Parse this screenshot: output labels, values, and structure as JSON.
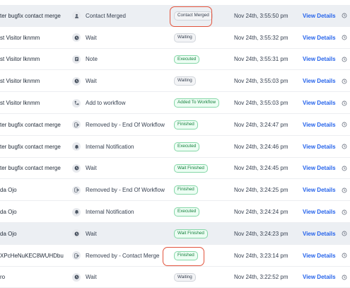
{
  "link_label": "View Details",
  "rows": [
    {
      "contact": "ter bugfix contact merge",
      "icon": "person-icon",
      "action": "Contact Merged",
      "status": "Contact Merged",
      "status_style": "grey",
      "date": "Nov 24th, 3:55:50 pm",
      "highlight": true
    },
    {
      "contact": "st Visitor lknmm",
      "icon": "clock-icon",
      "action": "Wait",
      "status": "Waiting",
      "status_style": "grey",
      "date": "Nov 24th, 3:55:32 pm",
      "highlight": false
    },
    {
      "contact": "st Visitor lknmm",
      "icon": "note-icon",
      "action": "Note",
      "status": "Executed",
      "status_style": "green",
      "date": "Nov 24th, 3:55:31 pm",
      "highlight": false
    },
    {
      "contact": "st Visitor lknmm",
      "icon": "clock-icon",
      "action": "Wait",
      "status": "Waiting",
      "status_style": "grey",
      "date": "Nov 24th, 3:55:03 pm",
      "highlight": false
    },
    {
      "contact": "st Visitor lknmm",
      "icon": "workflow-icon",
      "action": "Add to workflow",
      "status": "Added To Workflow",
      "status_style": "green",
      "date": "Nov 24th, 3:55:03 pm",
      "highlight": false
    },
    {
      "contact": "ter bugfix contact merge",
      "icon": "exit-icon",
      "action": "Removed by - End Of Workflow",
      "status": "Finished",
      "status_style": "green",
      "date": "Nov 24th, 3:24:47 pm",
      "highlight": false
    },
    {
      "contact": "ter bugfix contact merge",
      "icon": "bell-icon",
      "action": "Internal Notification",
      "status": "Executed",
      "status_style": "green",
      "date": "Nov 24th, 3:24:46 pm",
      "highlight": false
    },
    {
      "contact": "ter bugfix contact merge",
      "icon": "clock-icon",
      "action": "Wait",
      "status": "Wait Finished",
      "status_style": "green",
      "date": "Nov 24th, 3:24:45 pm",
      "highlight": false
    },
    {
      "contact": "da Ojo",
      "icon": "exit-icon",
      "action": "Removed by - End Of Workflow",
      "status": "Finished",
      "status_style": "green",
      "date": "Nov 24th, 3:24:25 pm",
      "highlight": false
    },
    {
      "contact": "da Ojo",
      "icon": "bell-icon",
      "action": "Internal Notification",
      "status": "Executed",
      "status_style": "green",
      "date": "Nov 24th, 3:24:24 pm",
      "highlight": false
    },
    {
      "contact": "da Ojo",
      "icon": "clock-icon",
      "action": "Wait",
      "status": "Wait Finished",
      "status_style": "green",
      "date": "Nov 24th, 3:24:23 pm",
      "highlight": true
    },
    {
      "contact": "XPcHeNuKEC8WUHDbu",
      "icon": "exit-icon",
      "action": "Removed by - Contact Merge",
      "status": "Finished",
      "status_style": "green",
      "date": "Nov 24th, 3:23:14 pm",
      "highlight": false
    },
    {
      "contact": "ro",
      "icon": "clock-icon",
      "action": "Wait",
      "status": "Waiting",
      "status_style": "grey",
      "date": "Nov 24th, 3:22:52 pm",
      "highlight": false
    }
  ]
}
